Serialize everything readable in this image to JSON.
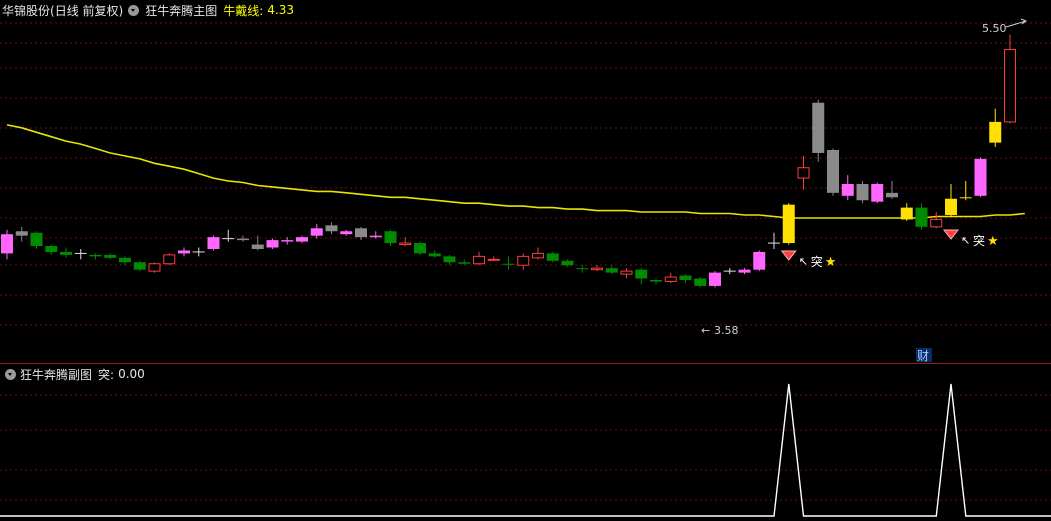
{
  "header": {
    "stock_name": "华锦股份",
    "mode": "(日线 前复权)",
    "main_indicator": "狂牛奔腾主图",
    "line_label": "牛戴线:",
    "line_value": "4.33"
  },
  "subchart": {
    "title": "狂牛奔腾副图",
    "signal_label": "突:",
    "signal_value": "0.00"
  },
  "annotations": {
    "high_label": "5.50",
    "low_label": "3.58",
    "signal_text": "突",
    "cai_label": "财"
  },
  "colors": {
    "background": "#000000",
    "up": "#ff3c3c",
    "down": "#008a00",
    "pink": "#ff66ff",
    "gray": "#8a8a8a",
    "yellow": "#ffe000",
    "ma_line": "#e6e600",
    "grid": "#6e1010"
  },
  "chart_data": {
    "type": "candlestick",
    "price_ylim": [
      3.4,
      5.6
    ],
    "candles": [
      {
        "o": 4.02,
        "c": 4.15,
        "h": 4.18,
        "l": 3.98,
        "k": "pink"
      },
      {
        "o": 4.17,
        "c": 4.14,
        "h": 4.2,
        "l": 4.1,
        "k": "gray"
      },
      {
        "o": 4.16,
        "c": 4.07,
        "h": 4.17,
        "l": 4.05,
        "k": "down"
      },
      {
        "o": 4.07,
        "c": 4.03,
        "h": 4.08,
        "l": 4.01,
        "k": "down"
      },
      {
        "o": 4.03,
        "c": 4.01,
        "h": 4.06,
        "l": 3.99,
        "k": "down"
      },
      {
        "o": 4.02,
        "c": 4.02,
        "h": 4.05,
        "l": 3.98,
        "k": "white"
      },
      {
        "o": 4.01,
        "c": 4.0,
        "h": 4.02,
        "l": 3.98,
        "k": "down"
      },
      {
        "o": 4.01,
        "c": 3.99,
        "h": 4.02,
        "l": 3.98,
        "k": "down"
      },
      {
        "o": 3.99,
        "c": 3.96,
        "h": 4.0,
        "l": 3.94,
        "k": "down"
      },
      {
        "o": 3.96,
        "c": 3.91,
        "h": 3.97,
        "l": 3.9,
        "k": "down"
      },
      {
        "o": 3.9,
        "c": 3.95,
        "h": 3.96,
        "l": 3.89,
        "k": "up"
      },
      {
        "o": 3.95,
        "c": 4.01,
        "h": 4.02,
        "l": 3.94,
        "k": "up"
      },
      {
        "o": 4.02,
        "c": 4.04,
        "h": 4.06,
        "l": 4.0,
        "k": "pink"
      },
      {
        "o": 4.03,
        "c": 4.03,
        "h": 4.06,
        "l": 4.0,
        "k": "white"
      },
      {
        "o": 4.05,
        "c": 4.13,
        "h": 4.14,
        "l": 4.04,
        "k": "pink"
      },
      {
        "o": 4.12,
        "c": 4.12,
        "h": 4.18,
        "l": 4.1,
        "k": "white"
      },
      {
        "o": 4.12,
        "c": 4.11,
        "h": 4.14,
        "l": 4.1,
        "k": "gray"
      },
      {
        "o": 4.08,
        "c": 4.05,
        "h": 4.14,
        "l": 4.04,
        "k": "gray"
      },
      {
        "o": 4.06,
        "c": 4.11,
        "h": 4.12,
        "l": 4.05,
        "k": "pink"
      },
      {
        "o": 4.1,
        "c": 4.11,
        "h": 4.13,
        "l": 4.08,
        "k": "pink"
      },
      {
        "o": 4.1,
        "c": 4.13,
        "h": 4.14,
        "l": 4.09,
        "k": "pink"
      },
      {
        "o": 4.14,
        "c": 4.19,
        "h": 4.22,
        "l": 4.12,
        "k": "pink"
      },
      {
        "o": 4.21,
        "c": 4.17,
        "h": 4.23,
        "l": 4.15,
        "k": "gray"
      },
      {
        "o": 4.15,
        "c": 4.17,
        "h": 4.18,
        "l": 4.14,
        "k": "pink"
      },
      {
        "o": 4.19,
        "c": 4.13,
        "h": 4.2,
        "l": 4.11,
        "k": "gray"
      },
      {
        "o": 4.13,
        "c": 4.14,
        "h": 4.17,
        "l": 4.12,
        "k": "pink"
      },
      {
        "o": 4.17,
        "c": 4.09,
        "h": 4.18,
        "l": 4.07,
        "k": "down"
      },
      {
        "o": 4.08,
        "c": 4.09,
        "h": 4.13,
        "l": 4.07,
        "k": "up"
      },
      {
        "o": 4.09,
        "c": 4.02,
        "h": 4.1,
        "l": 4.01,
        "k": "down"
      },
      {
        "o": 4.02,
        "c": 4.0,
        "h": 4.04,
        "l": 3.99,
        "k": "down"
      },
      {
        "o": 4.0,
        "c": 3.96,
        "h": 4.01,
        "l": 3.94,
        "k": "down"
      },
      {
        "o": 3.96,
        "c": 3.95,
        "h": 3.98,
        "l": 3.94,
        "k": "down"
      },
      {
        "o": 3.95,
        "c": 4.0,
        "h": 4.03,
        "l": 3.94,
        "k": "up"
      },
      {
        "o": 3.98,
        "c": 3.98,
        "h": 4.0,
        "l": 3.97,
        "k": "up"
      },
      {
        "o": 3.95,
        "c": 3.95,
        "h": 4.0,
        "l": 3.91,
        "k": "down"
      },
      {
        "o": 3.94,
        "c": 4.0,
        "h": 4.02,
        "l": 3.91,
        "k": "up"
      },
      {
        "o": 3.99,
        "c": 4.02,
        "h": 4.06,
        "l": 3.98,
        "k": "up"
      },
      {
        "o": 4.02,
        "c": 3.97,
        "h": 4.03,
        "l": 3.96,
        "k": "down"
      },
      {
        "o": 3.97,
        "c": 3.94,
        "h": 3.98,
        "l": 3.93,
        "k": "down"
      },
      {
        "o": 3.92,
        "c": 3.92,
        "h": 3.94,
        "l": 3.89,
        "k": "down"
      },
      {
        "o": 3.92,
        "c": 3.91,
        "h": 3.94,
        "l": 3.9,
        "k": "up"
      },
      {
        "o": 3.92,
        "c": 3.89,
        "h": 3.94,
        "l": 3.88,
        "k": "down"
      },
      {
        "o": 3.88,
        "c": 3.9,
        "h": 3.92,
        "l": 3.85,
        "k": "up"
      },
      {
        "o": 3.91,
        "c": 3.85,
        "h": 3.92,
        "l": 3.81,
        "k": "down"
      },
      {
        "o": 3.84,
        "c": 3.83,
        "h": 3.85,
        "l": 3.81,
        "k": "down"
      },
      {
        "o": 3.83,
        "c": 3.86,
        "h": 3.89,
        "l": 3.82,
        "k": "up"
      },
      {
        "o": 3.87,
        "c": 3.84,
        "h": 3.88,
        "l": 3.82,
        "k": "down"
      },
      {
        "o": 3.85,
        "c": 3.8,
        "h": 3.86,
        "l": 3.79,
        "k": "down"
      },
      {
        "o": 3.8,
        "c": 3.89,
        "h": 3.9,
        "l": 3.79,
        "k": "pink"
      },
      {
        "o": 3.9,
        "c": 3.9,
        "h": 3.92,
        "l": 3.88,
        "k": "white"
      },
      {
        "o": 3.89,
        "c": 3.91,
        "h": 3.92,
        "l": 3.88,
        "k": "pink"
      },
      {
        "o": 3.91,
        "c": 4.03,
        "h": 4.04,
        "l": 3.9,
        "k": "pink"
      },
      {
        "o": 4.09,
        "c": 4.09,
        "h": 4.16,
        "l": 4.05,
        "k": "white"
      },
      {
        "o": 4.09,
        "c": 4.35,
        "h": 4.36,
        "l": 4.08,
        "k": "yellow"
      },
      {
        "o": 4.53,
        "c": 4.6,
        "h": 4.68,
        "l": 4.45,
        "k": "up"
      },
      {
        "o": 4.7,
        "c": 5.04,
        "h": 5.06,
        "l": 4.64,
        "k": "gray"
      },
      {
        "o": 4.72,
        "c": 4.43,
        "h": 4.73,
        "l": 4.41,
        "k": "gray"
      },
      {
        "o": 4.49,
        "c": 4.41,
        "h": 4.55,
        "l": 4.38,
        "k": "pink"
      },
      {
        "o": 4.49,
        "c": 4.38,
        "h": 4.51,
        "l": 4.36,
        "k": "gray"
      },
      {
        "o": 4.37,
        "c": 4.49,
        "h": 4.5,
        "l": 4.36,
        "k": "pink"
      },
      {
        "o": 4.4,
        "c": 4.43,
        "h": 4.51,
        "l": 4.39,
        "k": "gray"
      },
      {
        "o": 4.33,
        "c": 4.25,
        "h": 4.36,
        "l": 4.24,
        "k": "yellow"
      },
      {
        "o": 4.33,
        "c": 4.2,
        "h": 4.36,
        "l": 4.18,
        "k": "down"
      },
      {
        "o": 4.2,
        "c": 4.25,
        "h": 4.3,
        "l": 4.19,
        "k": "up"
      },
      {
        "o": 4.28,
        "c": 4.39,
        "h": 4.49,
        "l": 4.27,
        "k": "yellow"
      },
      {
        "o": 4.4,
        "c": 4.4,
        "h": 4.51,
        "l": 4.38,
        "k": "yellow"
      },
      {
        "o": 4.41,
        "c": 4.66,
        "h": 4.67,
        "l": 4.4,
        "k": "pink"
      },
      {
        "o": 4.77,
        "c": 4.91,
        "h": 5.0,
        "l": 4.74,
        "k": "yellow"
      },
      {
        "o": 4.91,
        "c": 5.4,
        "h": 5.5,
        "l": 4.9,
        "k": "up"
      }
    ],
    "ma_line": [
      4.89,
      4.87,
      4.84,
      4.81,
      4.78,
      4.76,
      4.73,
      4.7,
      4.68,
      4.66,
      4.63,
      4.61,
      4.59,
      4.56,
      4.53,
      4.51,
      4.5,
      4.48,
      4.47,
      4.46,
      4.45,
      4.44,
      4.44,
      4.43,
      4.42,
      4.41,
      4.4,
      4.4,
      4.39,
      4.38,
      4.37,
      4.36,
      4.36,
      4.35,
      4.34,
      4.34,
      4.33,
      4.33,
      4.32,
      4.32,
      4.31,
      4.31,
      4.31,
      4.3,
      4.3,
      4.3,
      4.3,
      4.29,
      4.29,
      4.29,
      4.28,
      4.28,
      4.27,
      4.26,
      4.26,
      4.26,
      4.26,
      4.26,
      4.26,
      4.26,
      4.26,
      4.26,
      4.26,
      4.27,
      4.27,
      4.27,
      4.27,
      4.28,
      4.28,
      4.29
    ],
    "signals_at": [
      53,
      64
    ],
    "subchart_series": [
      0,
      0,
      0,
      0,
      0,
      0,
      0,
      0,
      0,
      0,
      0,
      0,
      0,
      0,
      0,
      0,
      0,
      0,
      0,
      0,
      0,
      0,
      0,
      0,
      0,
      0,
      0,
      0,
      0,
      0,
      0,
      0,
      0,
      0,
      0,
      0,
      0,
      0,
      0,
      0,
      0,
      0,
      0,
      0,
      0,
      0,
      0,
      0,
      0,
      0,
      0,
      0,
      0,
      1,
      0,
      0,
      0,
      0,
      0,
      0,
      0,
      0,
      0,
      0,
      1,
      0,
      0,
      0,
      0,
      0
    ],
    "subchart_ylim": [
      0,
      1
    ]
  }
}
